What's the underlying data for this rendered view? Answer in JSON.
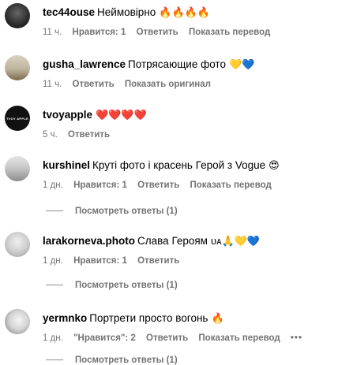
{
  "comments": [
    {
      "user": "tec44ouse",
      "text": "Неймовірно",
      "emoji": "🔥🔥🔥🔥",
      "time": "11 ч.",
      "likes": "Нравится: 1",
      "reply": "Ответить",
      "translate": "Показать перевод"
    },
    {
      "user": "gusha_lawrence",
      "text": "Потрясающие фото",
      "emoji": "💛💙",
      "time": "11 ч.",
      "reply": "Ответить",
      "translate": "Показать оригинал"
    },
    {
      "user": "tvoyapple",
      "text": "",
      "emoji": "❤️❤️❤️❤️",
      "time": "5 ч.",
      "reply": "Ответить"
    },
    {
      "user": "kurshinel",
      "text": "Круті фото і красень Герой з Vogue",
      "emoji": "😍",
      "time": "1 дн.",
      "likes": "Нравится: 1",
      "reply": "Ответить",
      "translate": "Показать перевод",
      "view_replies": "Посмотреть ответы (1)"
    },
    {
      "user": "larakorneva.photo",
      "text": "Слава Героям",
      "emoji": "ᴜᴀ🙏💛💙",
      "time": "1 дн.",
      "likes": "Нравится: 1",
      "reply": "Ответить",
      "view_replies": "Посмотреть ответы (1)"
    },
    {
      "user": "yermnko",
      "text": "Портрети просто вогонь",
      "emoji": "🔥",
      "time": "1 дн.",
      "likes": "\"Нравится\": 2",
      "reply": "Ответить",
      "translate": "Показать перевод",
      "more": "•••",
      "view_replies": "Посмотреть ответы (1)"
    }
  ],
  "avatars": {
    "tvoyapple_text": "TVOY APPLE"
  },
  "colors": {
    "muted": "#737373",
    "heart_red": "#ed4956"
  }
}
